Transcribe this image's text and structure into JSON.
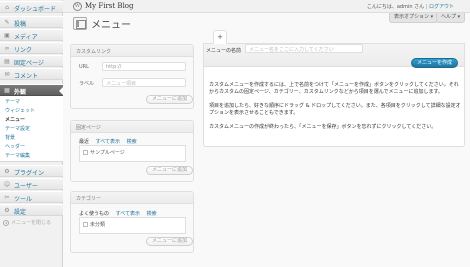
{
  "topbar": {
    "site_title": "My First Blog",
    "logo_glyph": "W",
    "greeting": "こんにちは、admin さん",
    "separator": "|",
    "logout": "ログアウト"
  },
  "screen_tabs": {
    "screen_options": "表示オプション ▾",
    "help": "ヘルプ ▾"
  },
  "sidebar": {
    "items": [
      {
        "label": "ダッシュボード",
        "icon": "dashboard-icon",
        "glyph": "⌂"
      },
      {
        "label": "投稿",
        "icon": "pin-icon",
        "glyph": "✎"
      },
      {
        "label": "メディア",
        "icon": "media-icon",
        "glyph": "▣"
      },
      {
        "label": "リンク",
        "icon": "link-icon",
        "glyph": "∞"
      },
      {
        "label": "固定ページ",
        "icon": "page-icon",
        "glyph": "▤"
      },
      {
        "label": "コメント",
        "icon": "comment-icon",
        "glyph": "✉"
      },
      {
        "label": "外観",
        "icon": "appearance-icon",
        "glyph": "▦"
      },
      {
        "label": "プラグイン",
        "icon": "plugin-icon",
        "glyph": "⚙"
      },
      {
        "label": "ユーザー",
        "icon": "users-icon",
        "glyph": "☺"
      },
      {
        "label": "ツール",
        "icon": "tools-icon",
        "glyph": "✂"
      },
      {
        "label": "設定",
        "icon": "settings-icon",
        "glyph": "⚙"
      }
    ],
    "submenu": [
      "テーマ",
      "ウィジェット",
      "メニュー",
      "テーマ設定",
      "背景",
      "ヘッダー",
      "テーマ編集"
    ],
    "collapse": "メニューを閉じる",
    "collapse_glyph": "◂"
  },
  "page": {
    "title": "メニュー"
  },
  "custom_links": {
    "title": "カスタムリンク",
    "url_label": "URL",
    "url_value": "http://",
    "label_label": "ラベル",
    "label_placeholder": "メニュー項目",
    "button": "メニューに追加"
  },
  "fixed_pages": {
    "title": "固定ページ",
    "tabs": [
      "最近",
      "すべて表示",
      "検索"
    ],
    "item": "サンプルページ",
    "button": "メニューに追加"
  },
  "categories": {
    "title": "カテゴリー",
    "tabs": [
      "よく使うもの",
      "すべて表示",
      "検索"
    ],
    "item": "未分類",
    "button": "メニューに追加"
  },
  "menu_editor": {
    "add_tab": "+",
    "name_label": "メニューの名前",
    "name_placeholder": "メニュー名をここに入力してください",
    "create_button": "メニューを作成",
    "desc1": "カスタムメニューを作成するには、上で名前をつけて「メニューを作成」ボタンをクリックしてください。それからカスタムの固定ページ、カテゴリー、カスタムリンクなどから項目を選んでメニューに追加します。",
    "desc2": "項目を追加したら、好きな順序にドラッグ & ドロップしてください。また、各項目をクリックして詳細な設定オプションを表示させることもできます。",
    "desc3": "カスタムメニューの作成が終わったら、「メニューを保存」ボタンを忘れずにクリックしてください。"
  }
}
